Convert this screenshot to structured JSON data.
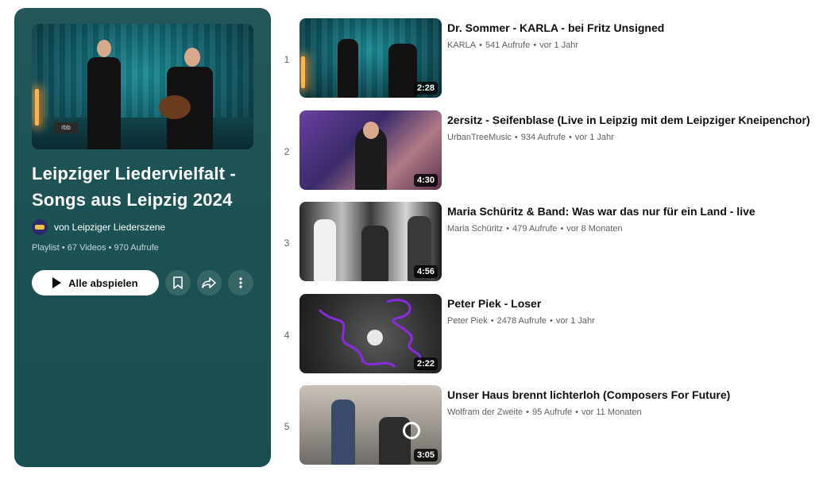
{
  "playlist": {
    "title_line1": "Leipziger Liedervielfalt -",
    "title_line2": "Songs aus Leipzig 2024",
    "owner": "von Leipziger Liederszene",
    "meta": "Playlist • 67 Videos • 970 Aufrufe",
    "play_all_label": "Alle abspielen",
    "hero_badge": "rbb"
  },
  "videos": [
    {
      "index": "1",
      "title": "Dr. Sommer - KARLA - bei Fritz Unsigned",
      "channel": "KARLA",
      "views": "541 Aufrufe",
      "age": "vor 1 Jahr",
      "duration": "2:28"
    },
    {
      "index": "2",
      "title": "2ersitz - Seifenblase (Live in Leipzig mit dem Leipziger Kneipenchor)",
      "channel": "UrbanTreeMusic",
      "views": "934 Aufrufe",
      "age": "vor 1 Jahr",
      "duration": "4:30"
    },
    {
      "index": "3",
      "title": "Maria Schüritz & Band: Was war das nur für ein Land - live",
      "channel": "Maria Schüritz",
      "views": "479 Aufrufe",
      "age": "vor 8 Monaten",
      "duration": "4:56"
    },
    {
      "index": "4",
      "title": "Peter Piek - Loser",
      "channel": "Peter Piek",
      "views": "2478 Aufrufe",
      "age": "vor 1 Jahr",
      "duration": "2:22"
    },
    {
      "index": "5",
      "title": "Unser Haus brennt lichterloh (Composers For Future)",
      "channel": "Wolfram der Zweite",
      "views": "95 Aufrufe",
      "age": "vor 11 Monaten",
      "duration": "3:05"
    }
  ],
  "colors": {
    "panel_bg": "#1d5254",
    "meta_text": "#606060",
    "title_text": "#0f0f0f"
  },
  "icons": [
    "play-icon",
    "save-icon",
    "share-icon",
    "more-icon"
  ]
}
